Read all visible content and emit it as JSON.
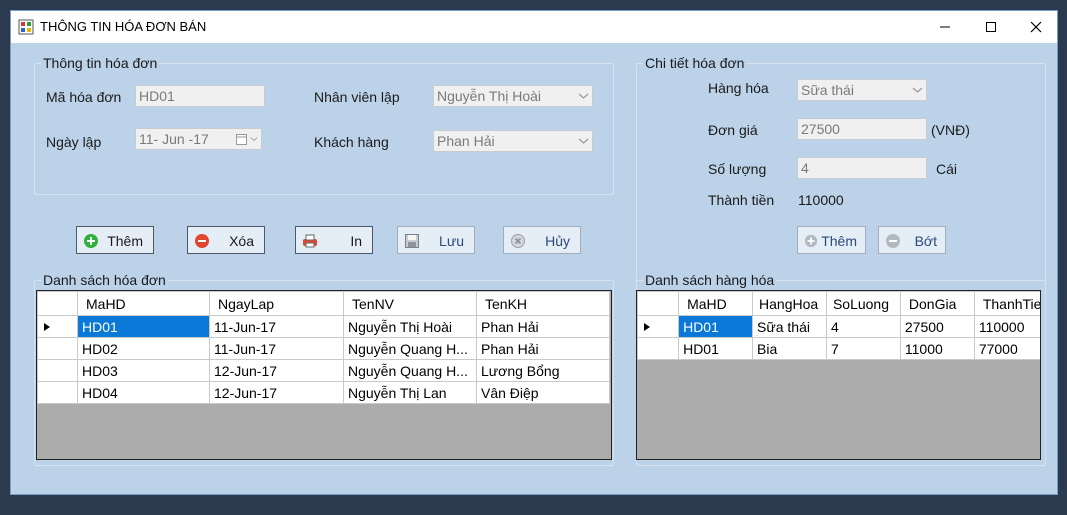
{
  "window": {
    "title": "THÔNG TIN HÓA ĐƠN BÁN",
    "icons": {
      "app": "app-icon",
      "minimize": "minimize-icon",
      "maximize": "maximize-icon",
      "close": "close-icon"
    }
  },
  "invoice_info": {
    "group_label": "Thông tin hóa đơn",
    "mahd_label": "Mã  hóa đơn",
    "mahd_value": "HD01",
    "ngaylap_label": "Ngày lập",
    "ngaylap_value": "11- Jun -17",
    "nhanvien_label": "Nhân viên lập",
    "nhanvien_value": "Nguyễn Thị Hoài",
    "khachhang_label": "Khách hàng",
    "khachhang_value": "Phan Hải"
  },
  "invoice_detail": {
    "group_label": "Chi tiết hóa đơn",
    "hanghoa_label": "Hàng hóa",
    "hanghoa_value": "Sữa thái",
    "dongia_label": "Đơn giá",
    "dongia_value": "27500",
    "dongia_unit": "(VNĐ)",
    "soluong_label": "Số lượng",
    "soluong_value": "4",
    "soluong_unit": "Cái",
    "thanhtien_label": "Thành tiền",
    "thanhtien_value": "110000"
  },
  "toolbar": {
    "them": "Thêm",
    "xoa": "Xóa",
    "in": "In",
    "luu": "Lưu",
    "huy": "Hủy"
  },
  "detail_toolbar": {
    "them": "Thêm",
    "bot": "Bớt"
  },
  "invoice_list": {
    "group_label": "Danh sách hóa đơn",
    "columns": [
      "MaHD",
      "NgayLap",
      "TenNV",
      "TenKH"
    ],
    "rows": [
      [
        "HD01",
        "11-Jun-17",
        "Nguyễn Thị Hoài",
        "Phan Hải"
      ],
      [
        "HD02",
        "11-Jun-17",
        "Nguyễn Quang H...",
        "Phan Hải"
      ],
      [
        "HD03",
        "12-Jun-17",
        "Nguyễn Quang H...",
        "Lương Bổng"
      ],
      [
        "HD04",
        "12-Jun-17",
        "Nguyễn Thị Lan",
        "Vân Điệp"
      ]
    ]
  },
  "goods_list": {
    "group_label": "Danh sách hàng hóa",
    "columns": [
      "MaHD",
      "HangHoa",
      "SoLuong",
      "DonGia",
      "ThanhTien"
    ],
    "rows": [
      [
        "HD01",
        "Sữa thái",
        "4",
        "27500",
        "110000"
      ],
      [
        "HD01",
        "Bia",
        "7",
        "11000",
        "77000"
      ]
    ]
  },
  "colors": {
    "window_bg": "#bcd2e8",
    "selection": "#0a78d7",
    "grid_empty": "#acacac"
  }
}
